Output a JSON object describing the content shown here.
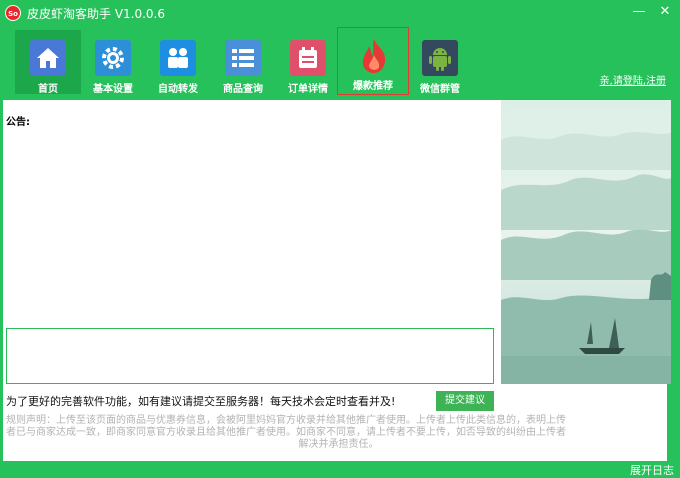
{
  "window": {
    "logo_text": "So",
    "title": "皮皮虾淘客助手 V1.0.0.6",
    "min_glyph": "—",
    "close_glyph": "✕"
  },
  "toolbar": {
    "items": [
      {
        "label": "首页",
        "icon": "home-icon",
        "color": "#3f6fd1"
      },
      {
        "label": "基本设置",
        "icon": "gear-icon",
        "color": "#2d8fd8"
      },
      {
        "label": "自动转发",
        "icon": "users-icon",
        "color": "#1e8fe0"
      },
      {
        "label": "商品查询",
        "icon": "list-icon",
        "color": "#4a90d9"
      },
      {
        "label": "订单详情",
        "icon": "calendar-icon",
        "color": "#e0506a"
      },
      {
        "label": "爆款推荐",
        "icon": "flame-icon",
        "color": "#e53935"
      },
      {
        "label": "微信群管",
        "icon": "android-icon",
        "color": "#34495e"
      }
    ],
    "login": "亲,请登陆,注册"
  },
  "main": {
    "announcement_label": "公告:",
    "suggest_prompt": "为了更好的完善软件功能，如有建议请提交至服务器！每天技术会定时查看并及!",
    "submit_button": "提交建议",
    "rules_line1": "规则声明：上传至该页面的商品与优惠券信息，会被阿里妈妈官方收录并给其他推广者使用。上传者上传此类信息的，表明上传",
    "rules_line2": "者已与商家达成一致，即商家同意官方收录且给其他推广者使用。如商家不同意，请上传者不要上传，如否导致的纠纷由上传者",
    "rules_line3": "解决并承担责任。"
  },
  "status": {
    "expand_log": "展开日志"
  }
}
